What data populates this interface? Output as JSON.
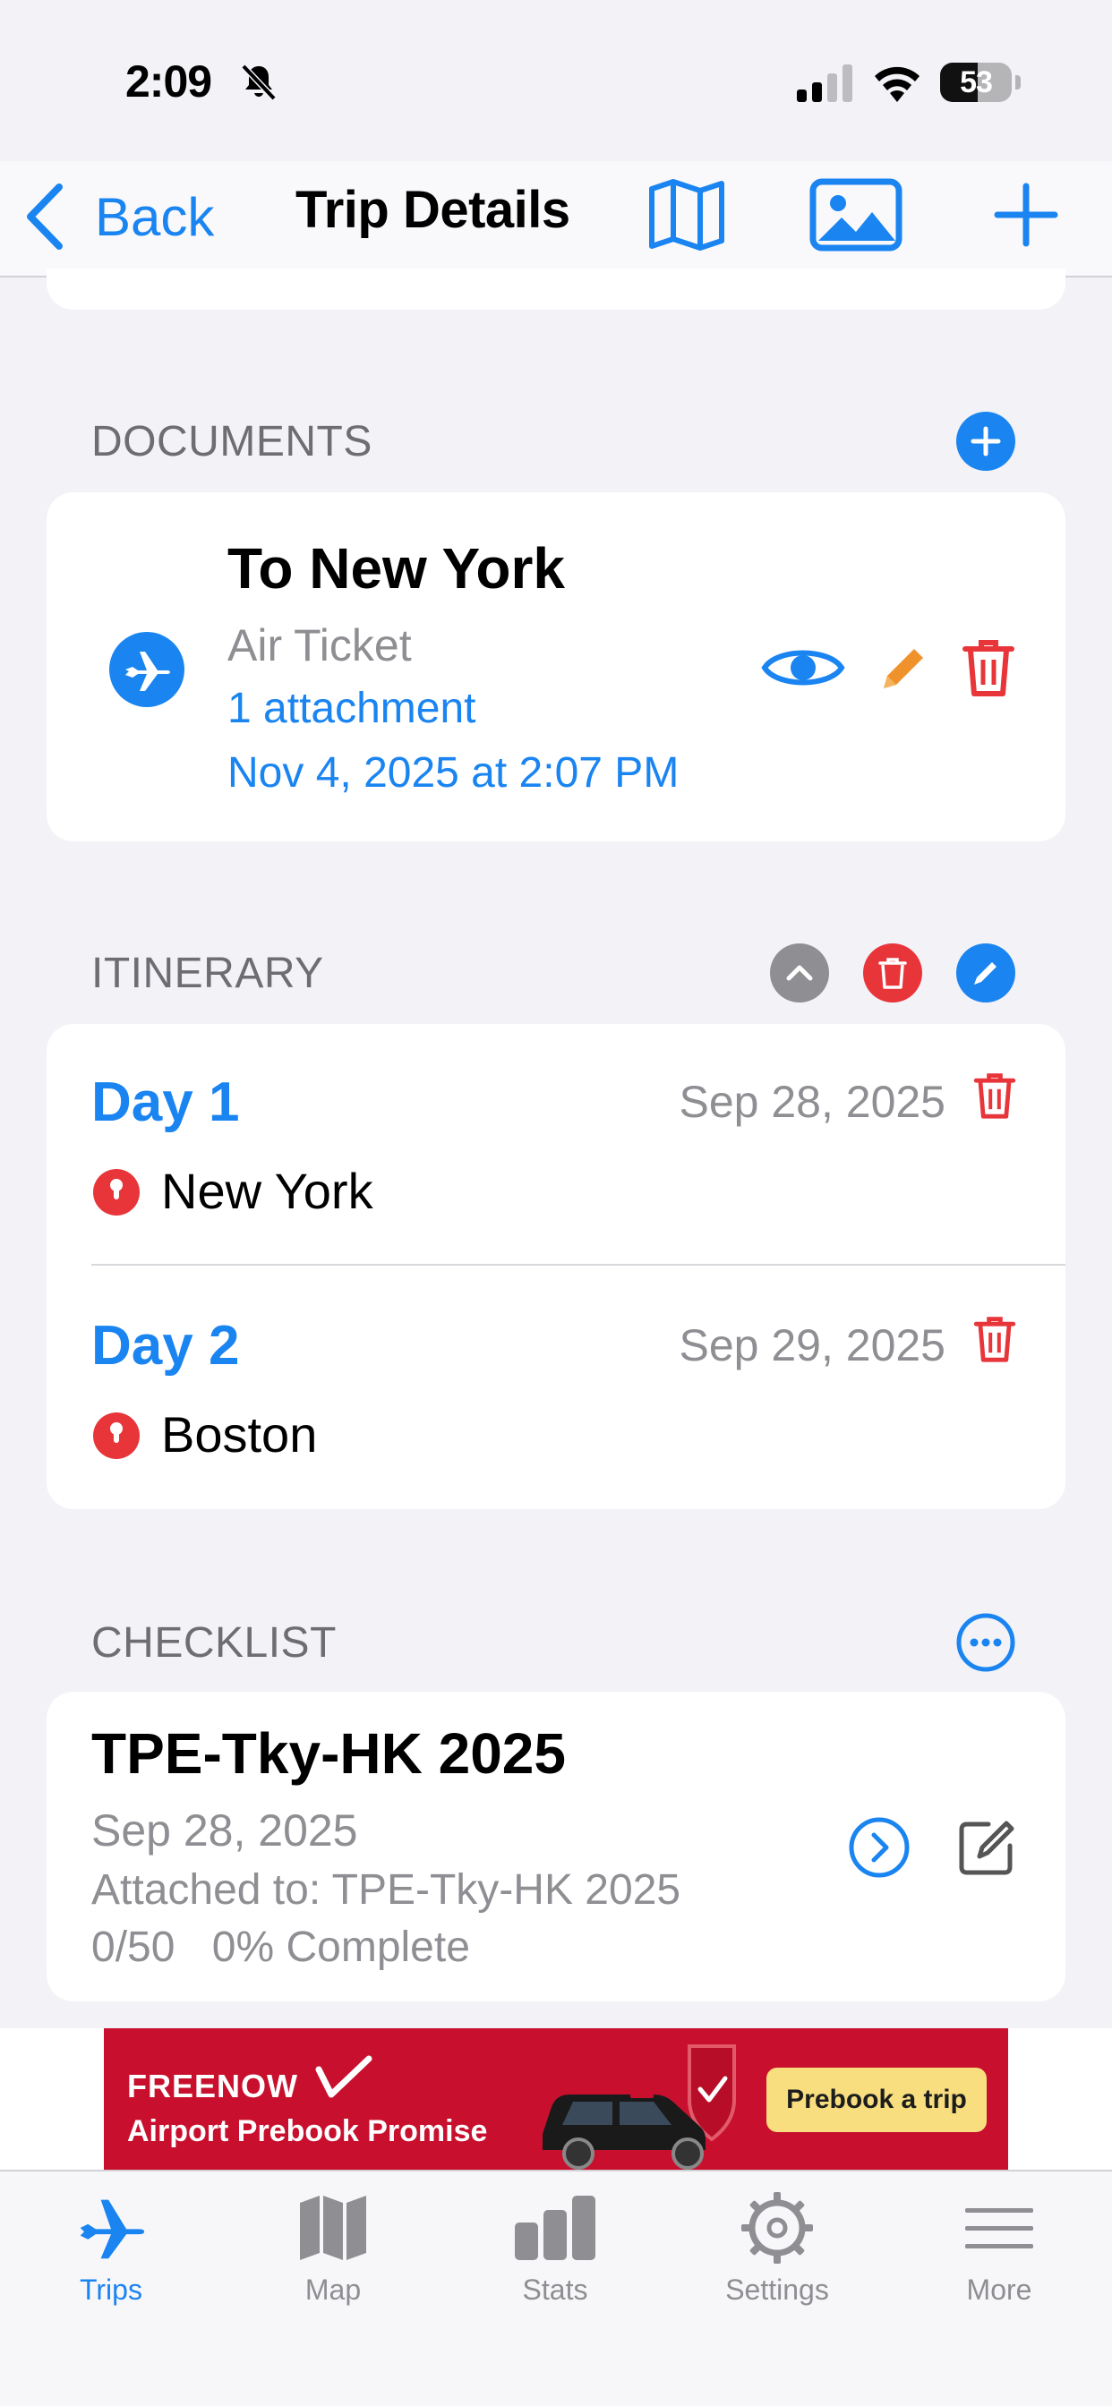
{
  "status_bar": {
    "time": "2:09",
    "battery_level": "53",
    "battery_fraction": 0.53
  },
  "nav": {
    "back_label": "Back",
    "title": "Trip Details",
    "icons": [
      "map-icon",
      "photo-icon",
      "plus-icon"
    ]
  },
  "documents": {
    "header": "DOCUMENTS",
    "items": [
      {
        "title": "To New York",
        "type": "Air Ticket",
        "attachments": "1 attachment",
        "date": "Nov 4, 2025 at 2:07 PM",
        "icon": "airplane-icon"
      }
    ]
  },
  "itinerary": {
    "header": "ITINERARY",
    "days": [
      {
        "label": "Day 1",
        "date": "Sep 28, 2025",
        "place": "New York"
      },
      {
        "label": "Day 2",
        "date": "Sep 29, 2025",
        "place": "Boston"
      }
    ]
  },
  "checklist": {
    "header": "CHECKLIST",
    "title": "TPE-Tky-HK 2025",
    "date": "Sep 28, 2025",
    "attached_to": "Attached to: TPE-Tky-HK 2025",
    "progress": "0/50",
    "percent": "0% Complete"
  },
  "ad": {
    "brand": "FREENOW",
    "promise": "Airport Prebook Promise",
    "cta": "Prebook a trip"
  },
  "tabs": [
    {
      "label": "Trips",
      "icon": "airplane-icon",
      "active": true
    },
    {
      "label": "Map",
      "icon": "map-icon",
      "active": false
    },
    {
      "label": "Stats",
      "icon": "bar-chart-icon",
      "active": false
    },
    {
      "label": "Settings",
      "icon": "gear-icon",
      "active": false
    },
    {
      "label": "More",
      "icon": "menu-lines-icon",
      "active": false
    }
  ],
  "colors": {
    "accent": "#1a84f1",
    "destructive": "#e8353a",
    "edit": "#f0922b",
    "background": "#f2f2f7"
  }
}
